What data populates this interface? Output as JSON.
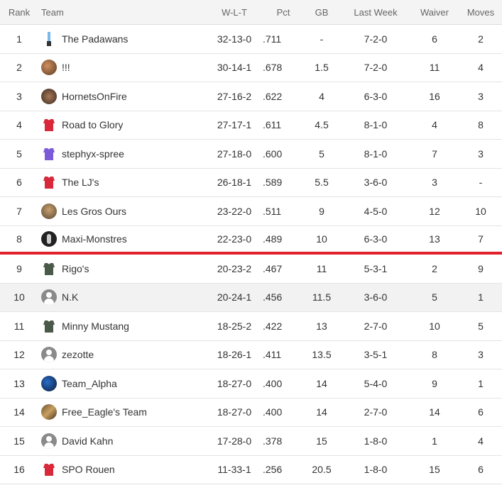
{
  "columns": {
    "rank": "Rank",
    "team": "Team",
    "wlt": "W-L-T",
    "pct": "Pct",
    "gb": "GB",
    "last_week": "Last Week",
    "waiver": "Waiver",
    "moves": "Moves"
  },
  "colors": {
    "playoff_cut_line": "#e0202a",
    "header_bg": "#f4f4f4",
    "highlight_row_bg": "#f2f2f2"
  },
  "rows": [
    {
      "rank": "1",
      "team": "The Padawans",
      "avatar": "saber-icon",
      "wlt": "32-13-0",
      "pct": ".711",
      "gb": "-",
      "last_week": "7-2-0",
      "waiver": "6",
      "moves": "2"
    },
    {
      "rank": "2",
      "team": "!!!",
      "avatar": "photo-icon",
      "wlt": "30-14-1",
      "pct": ".678",
      "gb": "1.5",
      "last_week": "7-2-0",
      "waiver": "11",
      "moves": "4"
    },
    {
      "rank": "3",
      "team": "HornetsOnFire",
      "avatar": "photo-icon",
      "wlt": "27-16-2",
      "pct": ".622",
      "gb": "4",
      "last_week": "6-3-0",
      "waiver": "16",
      "moves": "3"
    },
    {
      "rank": "4",
      "team": "Road to Glory",
      "avatar": "red-jersey-icon",
      "wlt": "27-17-1",
      "pct": ".611",
      "gb": "4.5",
      "last_week": "8-1-0",
      "waiver": "4",
      "moves": "8"
    },
    {
      "rank": "5",
      "team": "stephyx-spree",
      "avatar": "purple-jersey-icon",
      "wlt": "27-18-0",
      "pct": ".600",
      "gb": "5",
      "last_week": "8-1-0",
      "waiver": "7",
      "moves": "3"
    },
    {
      "rank": "6",
      "team": "The LJ's",
      "avatar": "red-jersey-icon",
      "wlt": "26-18-1",
      "pct": ".589",
      "gb": "5.5",
      "last_week": "3-6-0",
      "waiver": "3",
      "moves": "-"
    },
    {
      "rank": "7",
      "team": "Les Gros Ours",
      "avatar": "photo-icon",
      "wlt": "23-22-0",
      "pct": ".511",
      "gb": "9",
      "last_week": "4-5-0",
      "waiver": "12",
      "moves": "10"
    },
    {
      "rank": "8",
      "team": "Maxi-Monstres",
      "avatar": "dark-photo-icon",
      "wlt": "22-23-0",
      "pct": ".489",
      "gb": "10",
      "last_week": "6-3-0",
      "waiver": "13",
      "moves": "7"
    },
    {
      "rank": "9",
      "team": "Rigo's",
      "avatar": "green-jersey-icon",
      "wlt": "20-23-2",
      "pct": ".467",
      "gb": "11",
      "last_week": "5-3-1",
      "waiver": "2",
      "moves": "9"
    },
    {
      "rank": "10",
      "team": "N.K",
      "avatar": "default-avatar-icon",
      "wlt": "20-24-1",
      "pct": ".456",
      "gb": "11.5",
      "last_week": "3-6-0",
      "waiver": "5",
      "moves": "1"
    },
    {
      "rank": "11",
      "team": "Minny Mustang",
      "avatar": "green-jersey-icon",
      "wlt": "18-25-2",
      "pct": ".422",
      "gb": "13",
      "last_week": "2-7-0",
      "waiver": "10",
      "moves": "5"
    },
    {
      "rank": "12",
      "team": "zezotte",
      "avatar": "default-avatar-icon",
      "wlt": "18-26-1",
      "pct": ".411",
      "gb": "13.5",
      "last_week": "3-5-1",
      "waiver": "8",
      "moves": "3"
    },
    {
      "rank": "13",
      "team": "Team_Alpha",
      "avatar": "photo-icon",
      "wlt": "18-27-0",
      "pct": ".400",
      "gb": "14",
      "last_week": "5-4-0",
      "waiver": "9",
      "moves": "1"
    },
    {
      "rank": "14",
      "team": "Free_Eagle's Team",
      "avatar": "photo-icon",
      "wlt": "18-27-0",
      "pct": ".400",
      "gb": "14",
      "last_week": "2-7-0",
      "waiver": "14",
      "moves": "6"
    },
    {
      "rank": "15",
      "team": "David Kahn",
      "avatar": "default-avatar-icon",
      "wlt": "17-28-0",
      "pct": ".378",
      "gb": "15",
      "last_week": "1-8-0",
      "waiver": "1",
      "moves": "4"
    },
    {
      "rank": "16",
      "team": "SPO Rouen",
      "avatar": "red-jersey-icon",
      "wlt": "11-33-1",
      "pct": ".256",
      "gb": "20.5",
      "last_week": "1-8-0",
      "waiver": "15",
      "moves": "6"
    }
  ]
}
